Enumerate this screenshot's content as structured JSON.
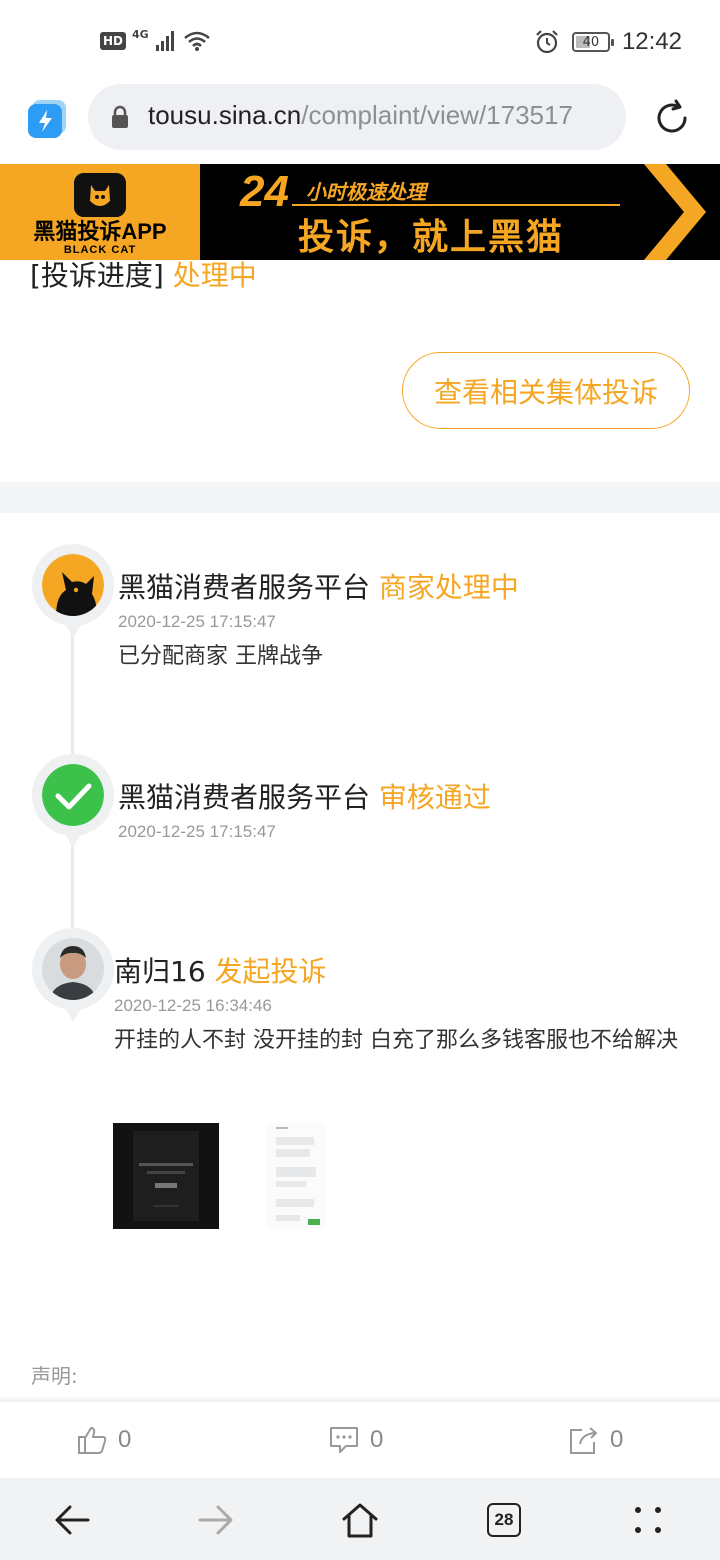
{
  "status_bar": {
    "hd": "HD",
    "network": "4G",
    "battery": "40",
    "battery_level_percent": 40,
    "time": "12:42",
    "icons": [
      "signal-icon",
      "wifi-icon",
      "alarm-icon",
      "battery-icon"
    ]
  },
  "browser": {
    "url_domain": "tousu.sina.cn",
    "url_path": "/complaint/view/173517",
    "icons": [
      "lock-icon",
      "reload-icon",
      "app-icon"
    ]
  },
  "banner": {
    "app_name": "黑猫投诉APP",
    "app_sub": "BLACK CAT",
    "hours": "24",
    "tagline_small": "小时极速处理",
    "tagline_main": "投诉，就上黑猫"
  },
  "complaint": {
    "progress_label": "[投诉进度]",
    "progress_value": "处理中",
    "group_button": "查看相关集体投诉"
  },
  "timeline": [
    {
      "actor": "黑猫消费者服务平台",
      "status": "商家处理中",
      "time": "2020-12-25 17:15:47",
      "text": "已分配商家 王牌战争",
      "avatar": "black-cat-logo"
    },
    {
      "actor": "黑猫消费者服务平台",
      "status": "审核通过",
      "time": "2020-12-25 17:15:47",
      "text": "",
      "avatar": "check-icon"
    },
    {
      "actor": "南归16",
      "status": "发起投诉",
      "time": "2020-12-25 16:34:46",
      "text": "开挂的人不封 没开挂的封 白充了那么多钱客服也不给解决",
      "avatar": "user-photo"
    }
  ],
  "disclaimer": {
    "label": "声明:"
  },
  "actions": {
    "like_count": "0",
    "comment_count": "0",
    "share_count": "0"
  },
  "nav": {
    "tab_count": "28"
  },
  "colors": {
    "accent": "#f5a623",
    "success": "#3cc24a",
    "banner_bg": "#000000"
  }
}
